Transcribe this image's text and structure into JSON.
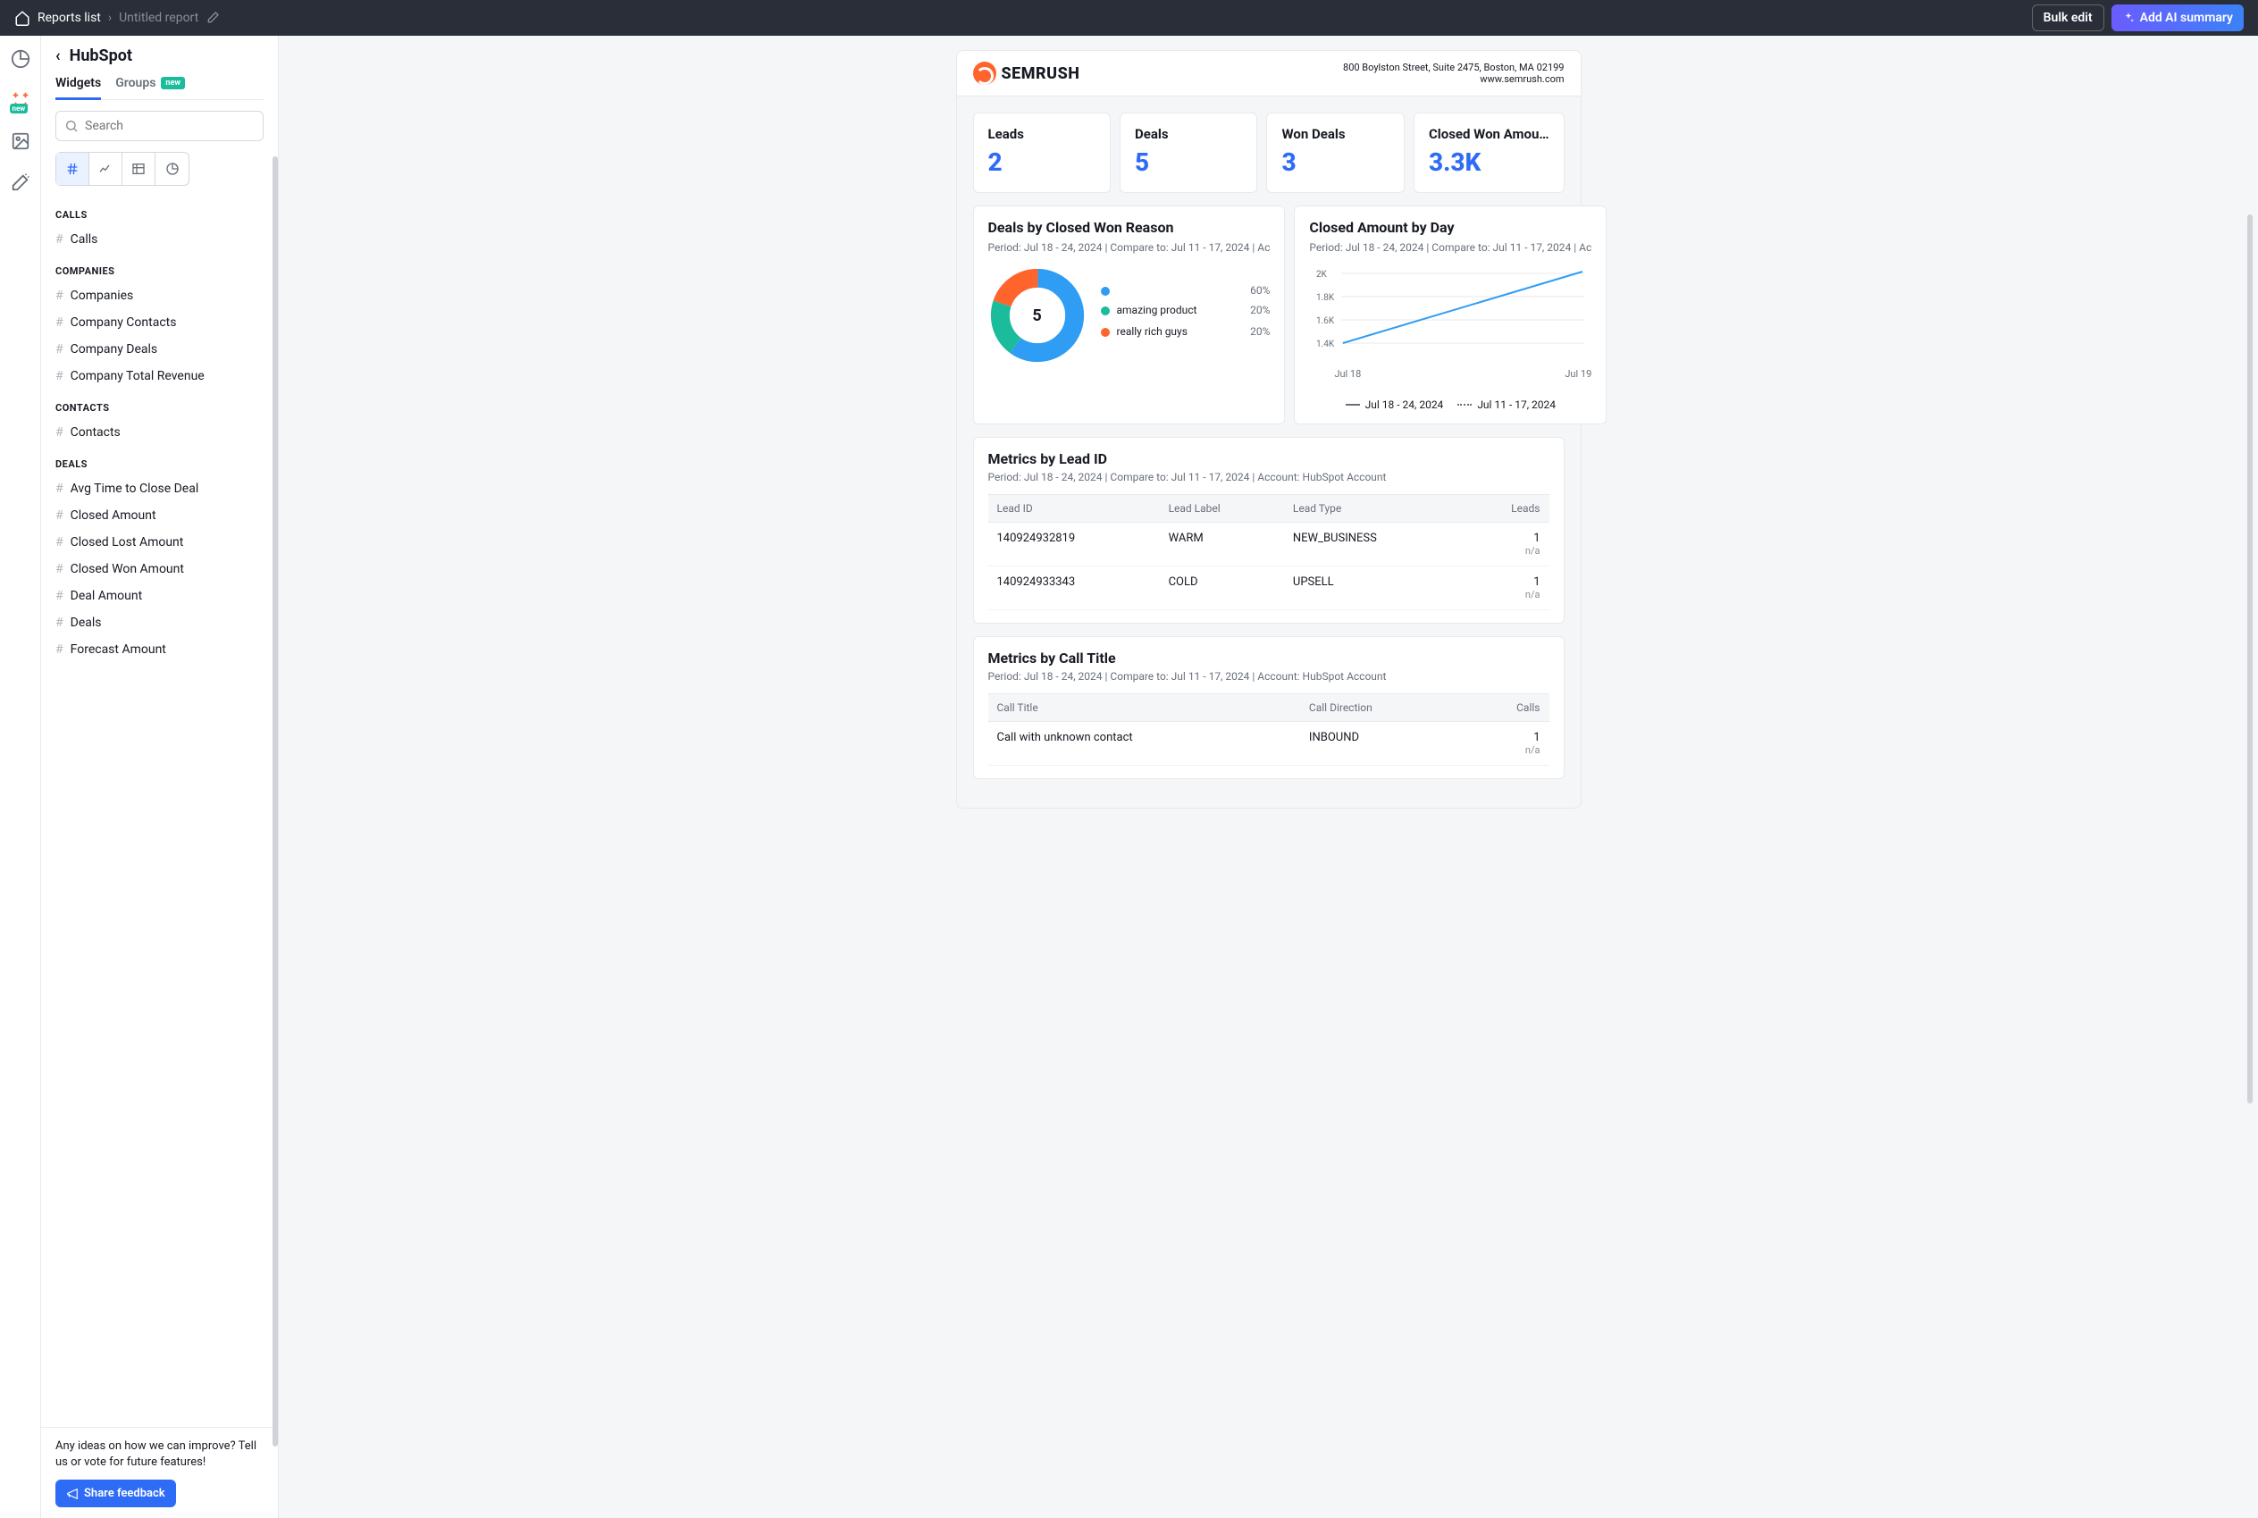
{
  "topbar": {
    "reports_list": "Reports list",
    "untitled": "Untitled report",
    "bulk_edit": "Bulk edit",
    "ai_summary": "Add AI summary"
  },
  "iconrail": {
    "new_badge": "new"
  },
  "sidebar": {
    "title": "HubSpot",
    "tab_widgets": "Widgets",
    "tab_groups": "Groups",
    "groups_badge": "new",
    "search_placeholder": "Search",
    "groups": [
      {
        "label": "CALLS",
        "items": [
          "Calls"
        ]
      },
      {
        "label": "COMPANIES",
        "items": [
          "Companies",
          "Company Contacts",
          "Company Deals",
          "Company Total Revenue"
        ]
      },
      {
        "label": "CONTACTS",
        "items": [
          "Contacts"
        ]
      },
      {
        "label": "DEALS",
        "items": [
          "Avg Time to Close Deal",
          "Closed Amount",
          "Closed Lost Amount",
          "Closed Won Amount",
          "Deal Amount",
          "Deals",
          "Forecast Amount"
        ]
      }
    ],
    "feedback_text": "Any ideas on how we can improve? Tell us or vote for future features!",
    "feedback_btn": "Share feedback"
  },
  "report": {
    "brand": "SEMRUSH",
    "address": "800 Boylston Street, Suite 2475, Boston, MA 02199",
    "url": "www.semrush.com",
    "stats": [
      {
        "label": "Leads",
        "value": "2"
      },
      {
        "label": "Deals",
        "value": "5"
      },
      {
        "label": "Won Deals",
        "value": "3"
      },
      {
        "label": "Closed Won Amou…",
        "value": "3.3K"
      }
    ],
    "donut": {
      "title": "Deals by Closed Won Reason",
      "sub": "Period: Jul 18 - 24, 2024 | Compare to: Jul 11 - 17, 2024 | Ac",
      "center": "5",
      "legend": [
        {
          "name": "",
          "pct": "60%",
          "color": "#2f9df4"
        },
        {
          "name": "amazing product",
          "pct": "20%",
          "color": "#1abc9c"
        },
        {
          "name": "really rich guys",
          "pct": "20%",
          "color": "#ff642d"
        }
      ]
    },
    "line": {
      "title": "Closed Amount by Day",
      "sub": "Period: Jul 18 - 24, 2024 | Compare to: Jul 11 - 17, 2024 | Ac",
      "yticks": [
        "2K",
        "1.8K",
        "1.6K",
        "1.4K"
      ],
      "xaxis": [
        "Jul 18",
        "Jul 19"
      ],
      "leg1": "Jul 18 - 24, 2024",
      "leg2": "Jul 11 - 17, 2024"
    },
    "table1": {
      "title": "Metrics by Lead ID",
      "sub": "Period: Jul 18 - 24, 2024 | Compare to: Jul 11 - 17, 2024 | Account: HubSpot Account",
      "headers": [
        "Lead ID",
        "Lead Label",
        "Lead Type",
        "Leads"
      ],
      "rows": [
        {
          "c0": "140924932819",
          "c1": "WARM",
          "c2": "NEW_BUSINESS",
          "c3": "1",
          "na": "n/a"
        },
        {
          "c0": "140924933343",
          "c1": "COLD",
          "c2": "UPSELL",
          "c3": "1",
          "na": "n/a"
        }
      ]
    },
    "table2": {
      "title": "Metrics by Call Title",
      "sub": "Period: Jul 18 - 24, 2024 | Compare to: Jul 11 - 17, 2024 | Account: HubSpot Account",
      "headers": [
        "Call Title",
        "Call Direction",
        "Calls"
      ],
      "rows": [
        {
          "c0": "Call with unknown contact",
          "c1": "INBOUND",
          "c2": "1",
          "na": "n/a"
        }
      ]
    }
  },
  "chart_data": [
    {
      "type": "pie",
      "title": "Deals by Closed Won Reason",
      "categories": [
        "(unnamed)",
        "amazing product",
        "really rich guys"
      ],
      "values": [
        60,
        20,
        20
      ],
      "total": 5
    },
    {
      "type": "line",
      "title": "Closed Amount by Day",
      "x": [
        "Jul 18",
        "Jul 19"
      ],
      "series": [
        {
          "name": "Jul 18 - 24, 2024",
          "values": [
            1400,
            2000
          ]
        },
        {
          "name": "Jul 11 - 17, 2024",
          "values": [
            null,
            null
          ]
        }
      ],
      "ylim": [
        1400,
        2000
      ],
      "ylabel": "",
      "xlabel": ""
    }
  ]
}
